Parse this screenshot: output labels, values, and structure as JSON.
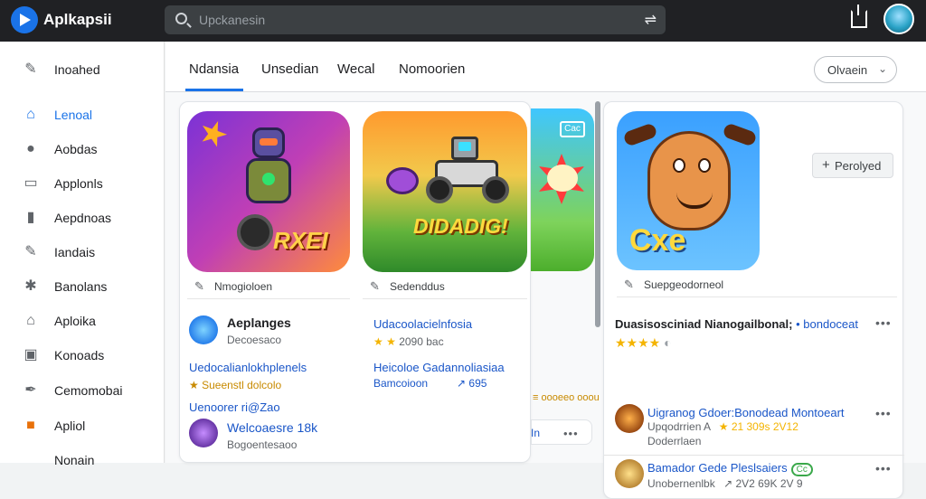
{
  "app": {
    "title": "Aplkapsii"
  },
  "search": {
    "placeholder": "Upckanesin",
    "action_icon": "share-swap-icon"
  },
  "sidebar": {
    "items": [
      {
        "label": "Inoahed",
        "icon": "pencil-icon"
      },
      {
        "label": "Lenoal",
        "icon": "store-icon",
        "active": true
      },
      {
        "label": "Aobdas",
        "icon": "person-icon"
      },
      {
        "label": "Applonls",
        "icon": "image-icon"
      },
      {
        "label": "Aepdnoas",
        "icon": "book-icon"
      },
      {
        "label": "Iandais",
        "icon": "pencil-icon"
      },
      {
        "label": "Banolans",
        "icon": "gear-icon"
      },
      {
        "label": "Aploika",
        "icon": "home-icon"
      },
      {
        "label": "Konoads",
        "icon": "bookmark-icon"
      },
      {
        "label": "Cemomobai",
        "icon": "feather-icon"
      },
      {
        "label": "Apliol",
        "icon": "tag-icon"
      },
      {
        "label": "Nonain"
      }
    ]
  },
  "tabs": [
    {
      "label": "Ndansia",
      "active": true
    },
    {
      "label": "Unsedian"
    },
    {
      "label": "Wecal"
    },
    {
      "label": "Nomoorien"
    }
  ],
  "sort": {
    "label": "Olvaein"
  },
  "left_card": {
    "tiles": [
      {
        "text": "RXEI",
        "caption": "Nmogioloen"
      },
      {
        "text": "DIDADIG!",
        "caption": "Sedenddus"
      }
    ],
    "entries": [
      {
        "title": "Aeplanges",
        "sub": "Decoesaco"
      },
      {
        "title": "Udacoolacielnfosia",
        "rating_stars": "★ ★",
        "rating_text": "2090 bac"
      },
      {
        "title": "Uedocalianlokhplenels",
        "gold": "★ Sueenstl dolcolo"
      },
      {
        "title": "Heicoloe Gadannoliasiaa",
        "sub": "Bamcoioon",
        "extra": "↗ 695"
      },
      {
        "title": "Uenoorer ri@Zao"
      },
      {
        "title": "Welcoaesre 18k",
        "sub": "Bogoentesaoo"
      }
    ]
  },
  "strip": {
    "badge": "Cac",
    "caption": "≡ oooeeo ooou",
    "snippet": "In"
  },
  "right_card": {
    "tile_text": "Cxe",
    "pin_label": "Perolyed",
    "caption": "Suepgeodorneol",
    "headline": "Duasisosciniad Nianogailbonal;",
    "headline_link": "• bondoceat",
    "headline_stars": "★★★★",
    "entries": [
      {
        "title": "Uigranog Gdoer:Bonodead Montoeart",
        "sub": "Upqodrrien A",
        "rating": "★ 21 309s  2V12",
        "sub2": "Doderrlaen"
      },
      {
        "title": "Bamador Gede Pleslsaiers",
        "tag": "Cc",
        "sub": "Unobernenlbk",
        "rating": "↗ 2V2 69K  2V 9"
      }
    ]
  },
  "colors": {
    "accent": "#1a73e8",
    "topbar": "#202124",
    "link": "#1a56c8",
    "star": "#f4b400"
  }
}
